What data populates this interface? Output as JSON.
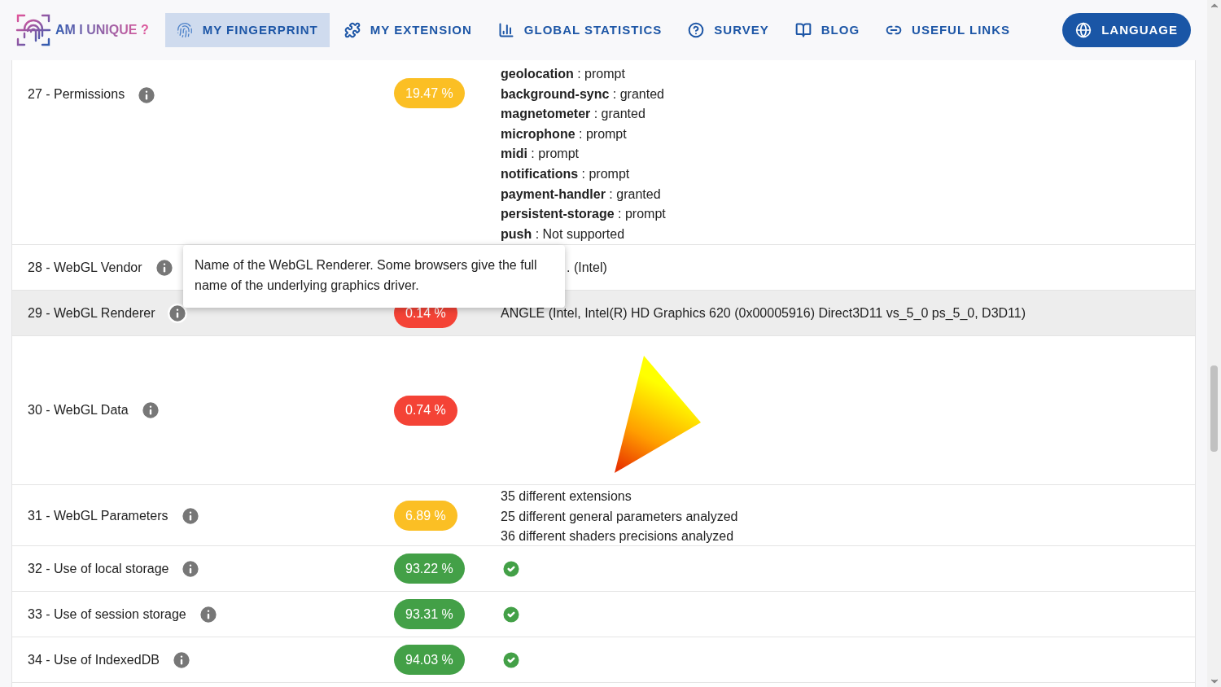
{
  "nav": {
    "logo_text": "AM I UNIQUE ?",
    "items": [
      {
        "label": "MY FINGERPRINT",
        "selected": true
      },
      {
        "label": "MY EXTENSION",
        "selected": false
      },
      {
        "label": "GLOBAL STATISTICS",
        "selected": false
      },
      {
        "label": "SURVEY",
        "selected": false
      },
      {
        "label": "BLOG",
        "selected": false
      },
      {
        "label": "USEFUL LINKS",
        "selected": false
      }
    ],
    "language_button": "LANGUAGE"
  },
  "rows": [
    {
      "label": "27 - Permissions",
      "badge": "19.47 %",
      "color": "#fbbf24",
      "selected": false,
      "kind": "permissions",
      "items": [
        "**geolocation** : prompt",
        "**background-sync** : granted",
        "**magnetometer** : granted",
        "**microphone** : prompt",
        "**midi** : prompt",
        "**notifications** : prompt",
        "**payment-handler** : granted",
        "**persistent-storage** : prompt",
        "**push** : Not supported"
      ]
    },
    {
      "label": "28 - WebGL Vendor",
      "selected": false,
      "kind": "partial",
      "value": ". (Intel)"
    },
    {
      "label": "29 - WebGL Renderer",
      "badge": "0.14 %",
      "color": "#f44336",
      "selected": true,
      "kind": "text",
      "value": "ANGLE (Intel, Intel(R) HD Graphics 620 (0x00005916) Direct3D11 vs_5_0 ps_5_0, D3D11)"
    },
    {
      "label": "30 - WebGL Data",
      "badge": "0.74 %",
      "color": "#f44336",
      "selected": false,
      "kind": "render"
    },
    {
      "label": "31 - WebGL Parameters",
      "badge": "6.89 %",
      "color": "#fbbf24",
      "selected": false,
      "kind": "lines",
      "lines": [
        "35 different extensions",
        "25 different general parameters analyzed",
        "36 different shaders precisions analyzed"
      ]
    },
    {
      "label": "32 - Use of local storage",
      "badge": "93.22 %",
      "color": "#43a047",
      "selected": false,
      "kind": "check"
    },
    {
      "label": "33 - Use of session storage",
      "badge": "93.31 %",
      "color": "#43a047",
      "selected": false,
      "kind": "check"
    },
    {
      "label": "34 - Use of IndexedDB",
      "badge": "94.03 %",
      "color": "#43a047",
      "selected": false,
      "kind": "check"
    }
  ],
  "tooltip": "Name of the WebGL Renderer. Some browsers give the full name of the underlying graphics driver."
}
